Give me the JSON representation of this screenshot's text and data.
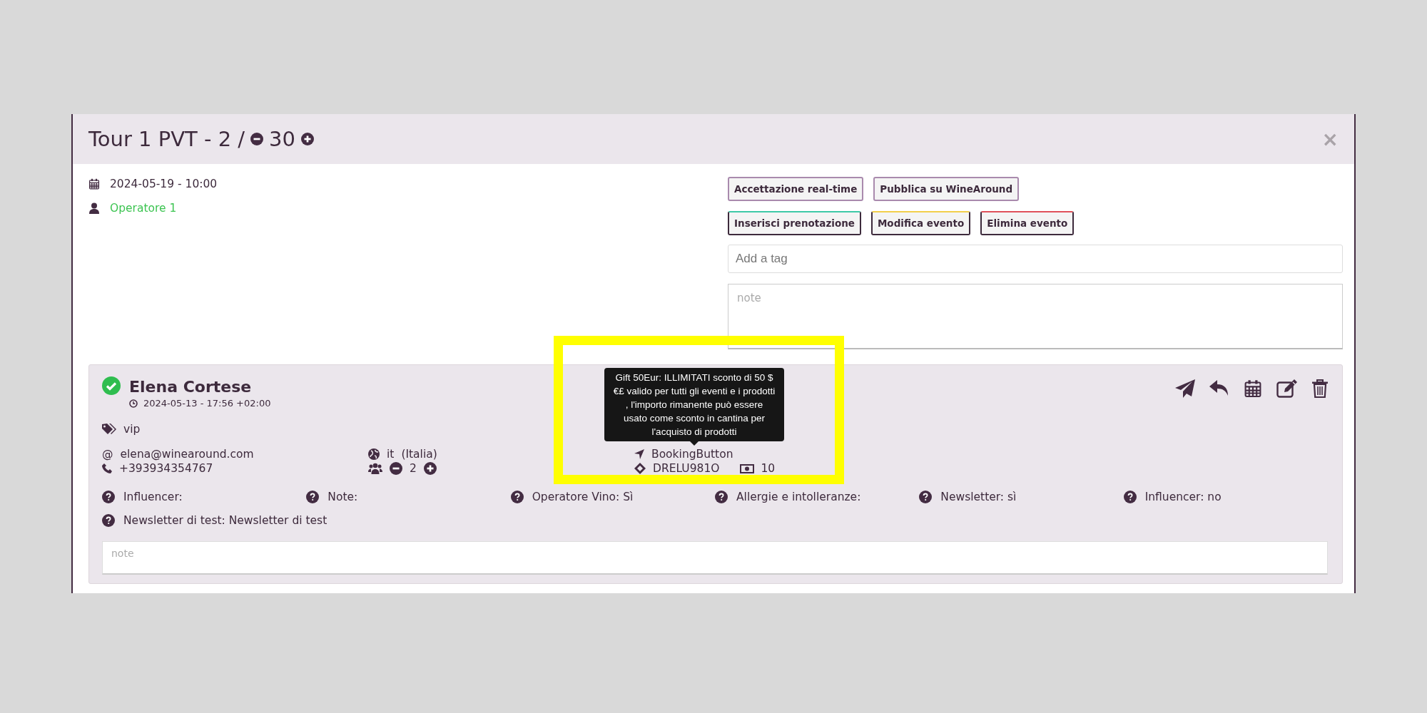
{
  "header": {
    "title": "Tour 1 PVT - 2 /",
    "capacity": "30",
    "close": "×"
  },
  "event": {
    "date": "2024-05-19 - 10:00",
    "operator": "Operatore 1"
  },
  "buttons": [
    {
      "label": "Accettazione real-time",
      "kind": "outline"
    },
    {
      "label": "Pubblica su WineAround",
      "kind": "outline"
    },
    {
      "label": "Inserisci prenotazione",
      "kind": "accent",
      "color": "#3ec9a7"
    },
    {
      "label": "Modifica evento",
      "kind": "accent",
      "color": "#f2d04b"
    },
    {
      "label": "Elimina evento",
      "kind": "accent",
      "color": "#e0515b"
    }
  ],
  "tag_input": {
    "placeholder": "Add a tag"
  },
  "note": {
    "placeholder": "note"
  },
  "booking": {
    "name": "Elena Cortese",
    "confirmed": true,
    "created": "2024-05-13 - 17:56 +02:00",
    "tags": [
      "vip"
    ],
    "email_mark": "@",
    "email": "elena@winearound.com",
    "phone": "+393934354767",
    "language": "it",
    "country": "(Italia)",
    "people": "2",
    "source": "BookingButton",
    "code": "DRELU981O",
    "amount": "10",
    "questions": [
      "Influencer:",
      "Note:",
      "Operatore Vino: Sì",
      "Allergie e intolleranze:",
      "Newsletter: sì",
      "Influencer: no",
      "Newsletter di test: Newsletter di test"
    ],
    "note": {
      "placeholder": "note"
    },
    "tooltip": "Gift 50Eur: ILLIMITATI sconto di 50 $€£ valido per tutti gli eventi e i prodotti , l'importo rimanente può essere usato come sconto in cantina per l'acquisto di prodotti"
  }
}
